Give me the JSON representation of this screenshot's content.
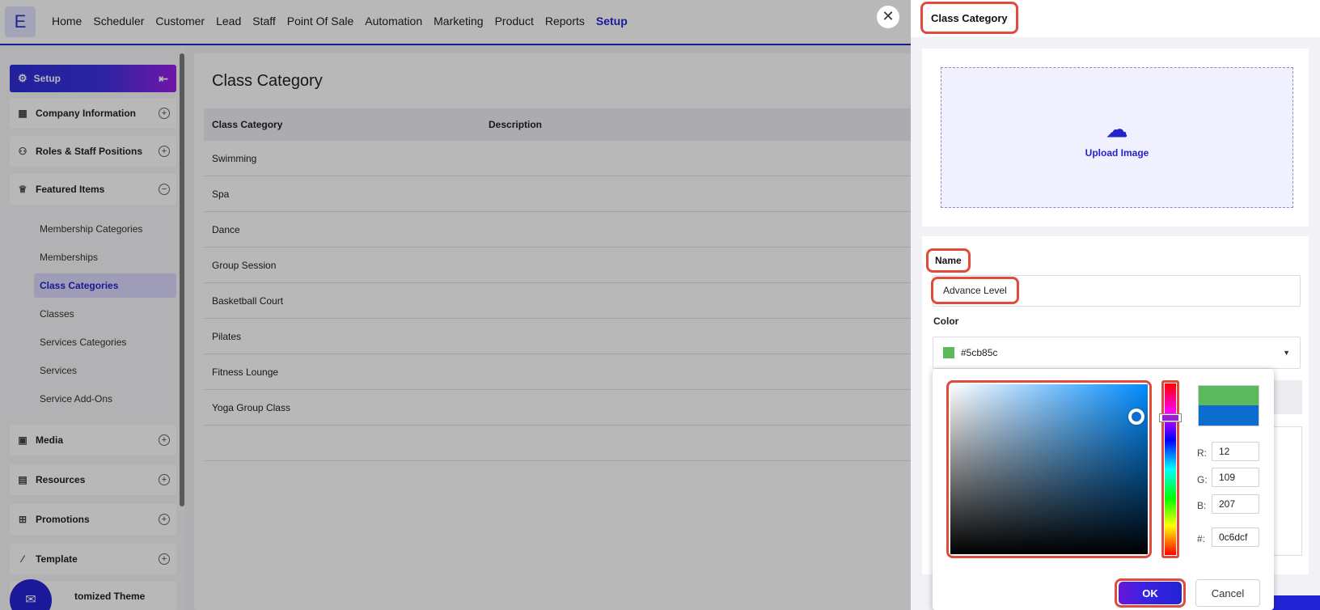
{
  "app": {
    "logo_letter": "E"
  },
  "nav": [
    "Home",
    "Scheduler",
    "Customer",
    "Lead",
    "Staff",
    "Point Of Sale",
    "Automation",
    "Marketing",
    "Product",
    "Reports",
    "Setup"
  ],
  "sidebar": {
    "header": "Setup",
    "sections": [
      {
        "label": "Company Information",
        "icon": "building-icon",
        "state": "collapsed"
      },
      {
        "label": "Roles & Staff Positions",
        "icon": "users-icon",
        "state": "collapsed"
      },
      {
        "label": "Featured Items",
        "icon": "crown-icon",
        "state": "expanded"
      },
      {
        "label": "Media",
        "icon": "media-icon",
        "state": "collapsed"
      },
      {
        "label": "Resources",
        "icon": "resources-icon",
        "state": "collapsed"
      },
      {
        "label": "Promotions",
        "icon": "gift-icon",
        "state": "collapsed"
      },
      {
        "label": "Template",
        "icon": "magic-wand-icon",
        "state": "collapsed"
      },
      {
        "label": "tomized Theme",
        "icon": "palette-icon",
        "state": "collapsed"
      }
    ],
    "featured_items": [
      "Membership Categories",
      "Memberships",
      "Class Categories",
      "Classes",
      "Services Categories",
      "Services",
      "Service Add-Ons"
    ],
    "active_item": "Class Categories"
  },
  "main": {
    "title": "Class Category",
    "columns": [
      "Class Category",
      "Description"
    ],
    "rows": [
      "Swimming",
      "Spa",
      "Dance",
      "Group Session",
      "Basketball Court",
      "Pilates",
      "Fitness Lounge",
      "Yoga Group Class"
    ]
  },
  "drawer": {
    "title": "Class Category",
    "upload_label": "Upload Image",
    "name_label": "Name",
    "name_value": "Advance Level",
    "color_label": "Color",
    "color_value": "#5cb85c",
    "close_glyph": "✕"
  },
  "picker": {
    "previous_color": "#5cb85c",
    "current_color": "#0c6dcf",
    "r_label": "R:",
    "r": "12",
    "g_label": "G:",
    "g": "109",
    "b_label": "B:",
    "b": "207",
    "hex_label": "#:",
    "hex": "0c6dcf",
    "ok_label": "OK",
    "cancel_label": "Cancel"
  },
  "colors": {
    "accent": "#2323d6",
    "highlight_frame": "#e04b3c",
    "active_item_bg": "#ddd9ff"
  }
}
